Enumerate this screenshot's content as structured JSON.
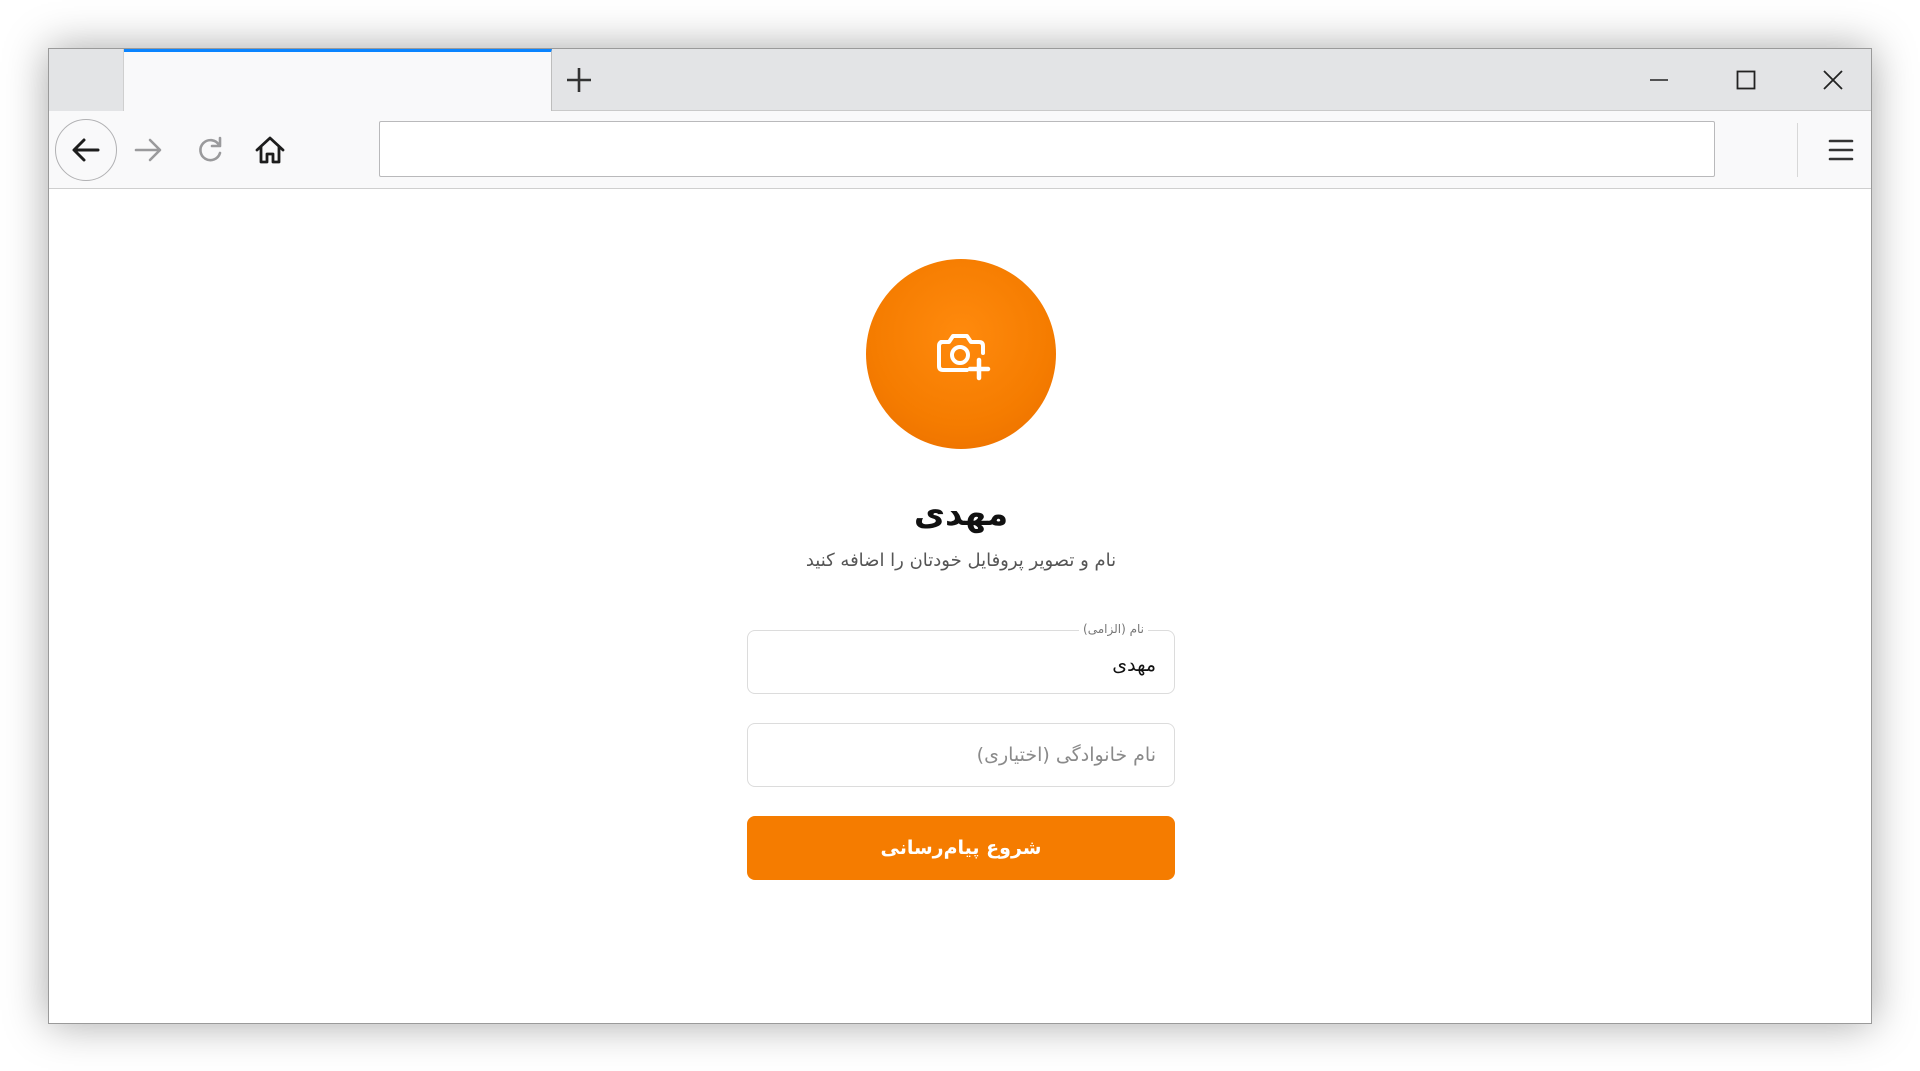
{
  "browser": {
    "new_tab_icon": "plus-icon",
    "window_controls": [
      "minimize-icon",
      "maximize-icon",
      "close-icon"
    ],
    "toolbar_icons": [
      "back-arrow-icon",
      "forward-arrow-icon",
      "reload-icon",
      "home-icon",
      "hamburger-menu-icon"
    ],
    "address_value": "",
    "active_tab_accent": "#0a84ff"
  },
  "profile": {
    "avatar_icon": "camera-plus-icon",
    "avatar_color": "#f57c00",
    "display_name": "مهدی",
    "subtitle": "نام و تصویر پروفایل خودتان را اضافه کنید"
  },
  "form": {
    "first_name_label": "نام (الزامی)",
    "first_name_value": "مهدی",
    "last_name_placeholder": "نام خانوادگی (اختیاری)",
    "last_name_value": "",
    "submit_label": "شروع پیام‌رسانی",
    "submit_color": "#f57c00"
  }
}
